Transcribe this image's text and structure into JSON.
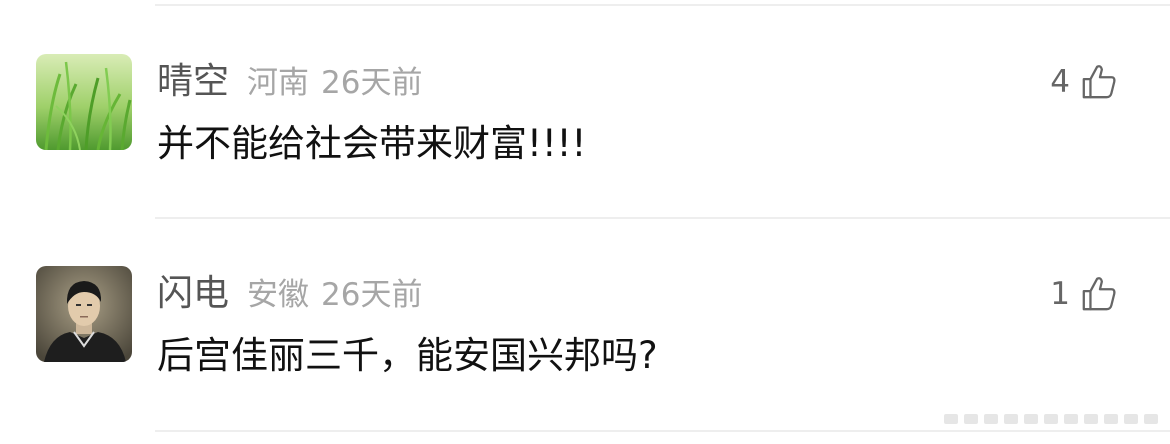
{
  "comments": [
    {
      "username": "晴空",
      "region": "河南",
      "time": "26天前",
      "likes": "4",
      "content": "并不能给社会带来财富!!!!",
      "avatar_icon": "grass-photo-icon"
    },
    {
      "username": "闪电",
      "region": "安徽",
      "time": "26天前",
      "likes": "1",
      "content": "后宫佳丽三千，能安国兴邦吗?",
      "avatar_icon": "portrait-photo-icon"
    }
  ],
  "icons": {
    "like": "thumbs-up-icon"
  },
  "colors": {
    "username": "#555555",
    "meta": "#a6a6a6",
    "content": "#111111",
    "divider": "#eeeeee"
  }
}
